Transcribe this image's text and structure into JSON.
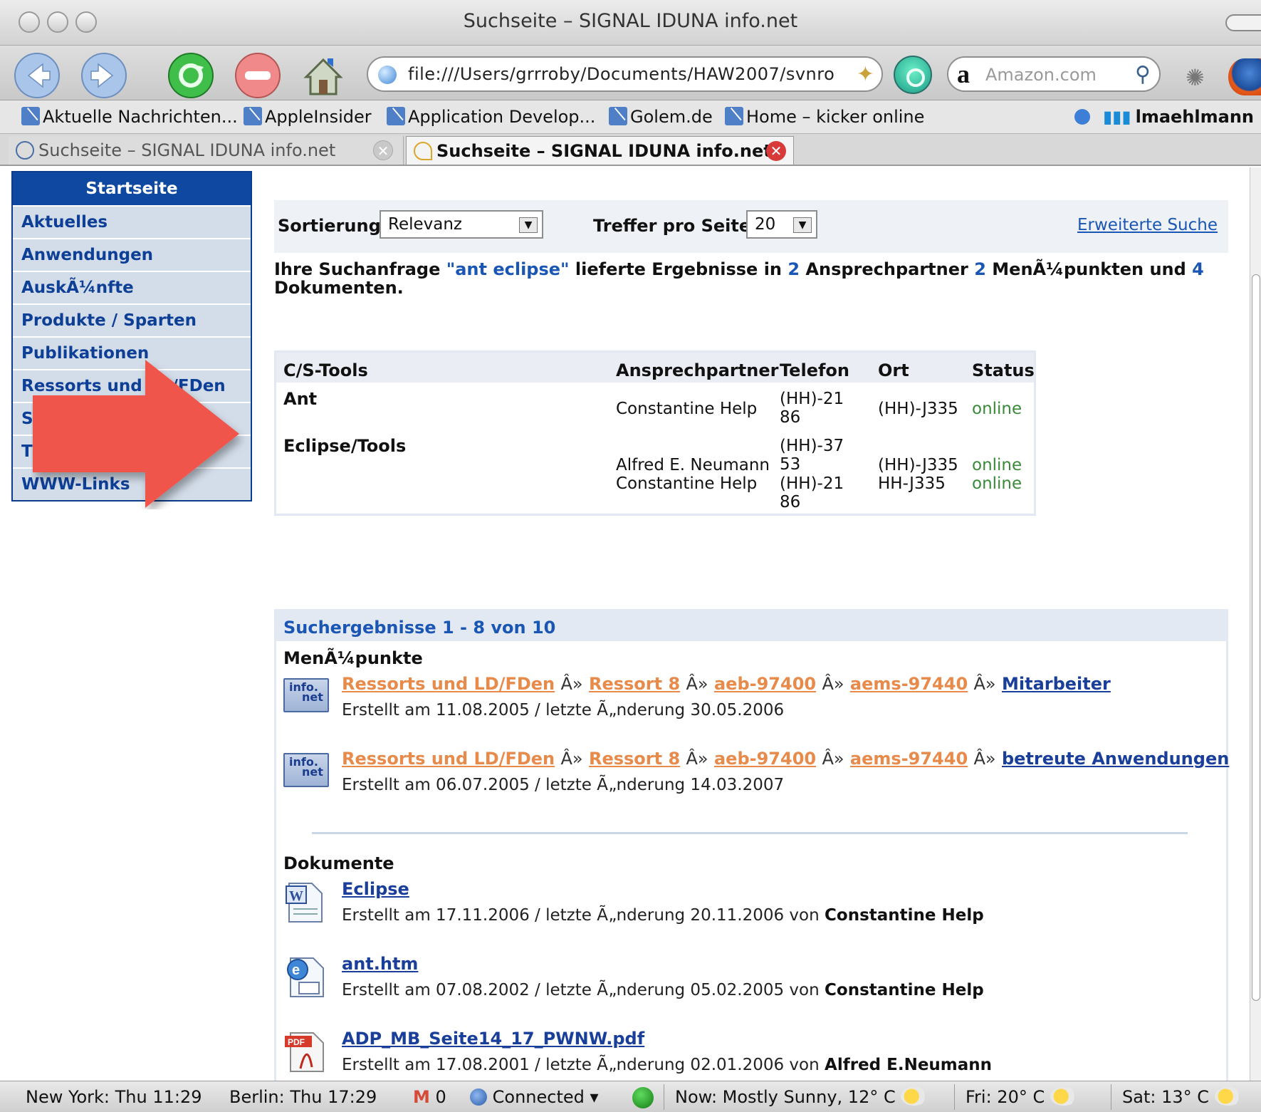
{
  "window": {
    "title": "Suchseite – SIGNAL IDUNA info.net"
  },
  "toolbar": {
    "url": "file:///Users/grrroby/Documents/HAW2007/svnro",
    "search_placeholder": "Amazon.com"
  },
  "bookmarks": [
    {
      "label": "Aktuelle Nachrichten..."
    },
    {
      "label": "AppleInsider"
    },
    {
      "label": "Application Develop..."
    },
    {
      "label": "Golem.de"
    },
    {
      "label": "Home – kicker online"
    }
  ],
  "bookmarks_right": "lmaehlmann",
  "tabs": [
    {
      "label": "Suchseite – SIGNAL IDUNA info.net"
    },
    {
      "label": "Suchseite – SIGNAL IDUNA info.net"
    }
  ],
  "sidebar": {
    "header": "Startseite",
    "items": [
      {
        "label": "Aktuelles"
      },
      {
        "label": "Anwendungen"
      },
      {
        "label": "AuskÃ¼nfte"
      },
      {
        "label": "Produkte / Sparten"
      },
      {
        "label": "Publikationen"
      },
      {
        "label": "Ressorts und LD/FDen"
      },
      {
        "label": "S"
      },
      {
        "label": "T"
      },
      {
        "label": "WWW-Links"
      }
    ]
  },
  "sort": {
    "label": "Sortierung",
    "value": "Relevanz",
    "per_page_label": "Treffer pro Seite",
    "per_page_value": "20",
    "advanced_link": "Erweiterte Suche"
  },
  "summary": {
    "part1": "Ihre Suchanfrage ",
    "query": "\"ant eclipse\"",
    "part2": " lieferte Ergebnisse in ",
    "n_contacts": "2",
    "part3": " Ansprechpartner ",
    "n_menu": "2",
    "part4": " MenÃ¼punkten und ",
    "n_docs": "4",
    "part5": "Dokumenten."
  },
  "contacts": {
    "headers": {
      "tool": "C/S-Tools",
      "person": "Ansprechpartner",
      "phone": "Telefon",
      "place": "Ort",
      "status": "Status"
    },
    "groups": [
      {
        "tool": "Ant",
        "rows": [
          {
            "person": "Constantine Help",
            "phone1": "(HH)-21",
            "phone2": "86",
            "place": "(HH)-J335",
            "status": "online"
          }
        ]
      },
      {
        "tool": "Eclipse/Tools",
        "rows": [
          {
            "person": "Alfred E. Neumann",
            "phone1": "(HH)-37",
            "phone2": "53",
            "place": "(HH)-J335",
            "status": "online"
          },
          {
            "person": "Constantine Help",
            "phone1": "(HH)-21",
            "phone2": "86",
            "place": "HH-J335",
            "status": "online"
          }
        ]
      }
    ]
  },
  "results": {
    "header": "Suchergebnisse 1 - 8 von 10",
    "menu_title": "MenÃ¼punkte",
    "menu_items": [
      {
        "crumbs": [
          "Ressorts und LD/FDen",
          "Ressort 8",
          "aeb-97400",
          "aems-97440"
        ],
        "target": "Mitarbeiter",
        "meta": "Erstellt am 11.08.2005 / letzte Ã„nderung 30.05.2006"
      },
      {
        "crumbs": [
          "Ressorts und LD/FDen",
          "Ressort 8",
          "aeb-97400",
          "aems-97440"
        ],
        "target": "betreute Anwendungen",
        "meta": "Erstellt am 06.07.2005 / letzte Ã„nderung 14.03.2007"
      }
    ],
    "crumb_sep": "Â»",
    "icon_text_1": "info.",
    "icon_text_2": "net",
    "docs_title": "Dokumente",
    "docs": [
      {
        "title": "Eclipse",
        "meta": "Erstellt am 17.11.2006 / letzte Ã„nderung 20.11.2006 von ",
        "author": "Constantine Help",
        "icon": "word-doc-icon"
      },
      {
        "title": "ant.htm",
        "meta": "Erstellt am 07.08.2002 / letzte Ã„nderung 05.02.2005 von ",
        "author": "Constantine Help",
        "icon": "html-doc-icon"
      },
      {
        "title": "ADP_MB_Seite14_17_PWNW.pdf",
        "meta": "Erstellt am 17.08.2001 / letzte Ã„nderung 02.01.2006 von ",
        "author": "Alfred E.Neumann",
        "icon": "pdf-doc-icon"
      }
    ]
  },
  "statusbar": {
    "ny": "New York: Thu 11:29",
    "berlin": "Berlin: Thu 17:29",
    "mail_count": "0",
    "connected": "Connected",
    "weather_now": "Now: Mostly Sunny, 12° C",
    "weather_fri": "Fri: 20° C",
    "weather_sat": "Sat: 13° C"
  },
  "colors": {
    "nav_header": "#0e48a0",
    "nav_text": "#0d3f97",
    "link_orange": "#e78a4a",
    "link_blue": "#1a56b3",
    "online": "#3a8a3a",
    "arrow": "#f0544c"
  }
}
